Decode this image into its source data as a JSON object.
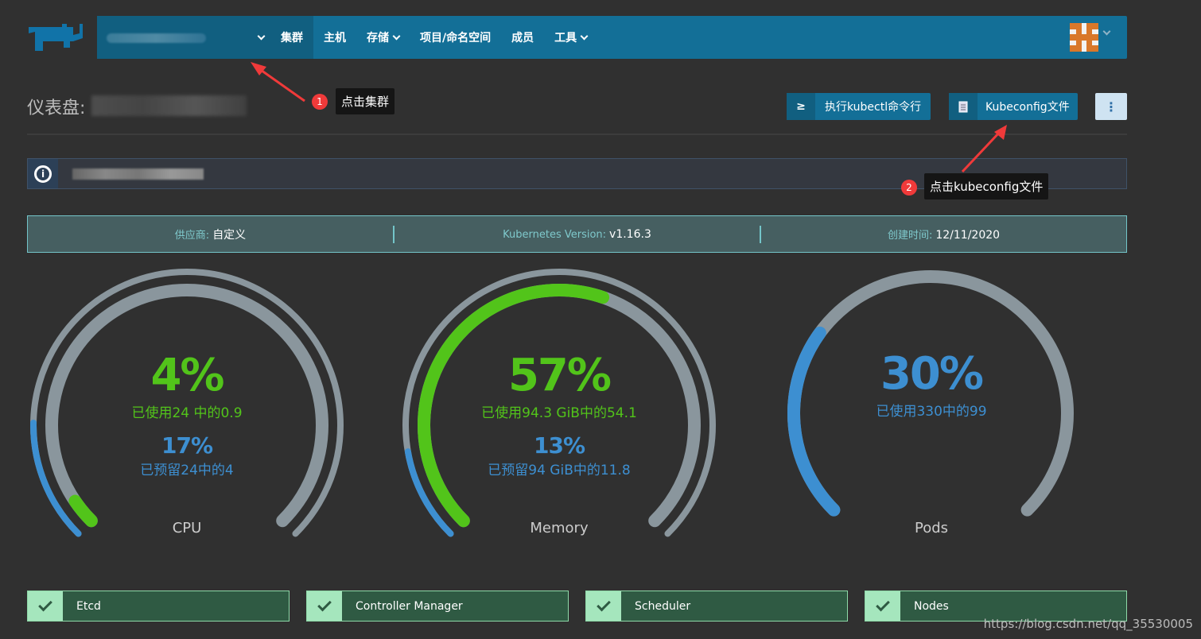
{
  "nav": {
    "items": [
      {
        "label": "集群",
        "active": true,
        "dropdown": false
      },
      {
        "label": "主机",
        "dropdown": false
      },
      {
        "label": "存储",
        "dropdown": true
      },
      {
        "label": "项目/命名空间",
        "dropdown": false
      },
      {
        "label": "成员",
        "dropdown": false
      },
      {
        "label": "工具",
        "dropdown": true
      }
    ]
  },
  "page": {
    "title": "仪表盘:"
  },
  "toolbar": {
    "kubectl_label": "执行kubectl命令行",
    "kubectl_icon": "≥",
    "kubeconfig_label": "Kubeconfig文件",
    "more_icon": "⋮"
  },
  "meta": {
    "provider_key": "供应商:",
    "provider_value": "自定义",
    "k8s_key": "Kubernetes Version:",
    "k8s_value": "v1.16.3",
    "created_key": "创建时间:",
    "created_value": "12/11/2020"
  },
  "gauges": [
    {
      "name": "CPU",
      "used_pct": "4%",
      "used_text": "已使用24 中的0.9",
      "used": 4,
      "reserved_pct": "17%",
      "reserved_text": "已预留24中的4",
      "reserved": 17
    },
    {
      "name": "Memory",
      "used_pct": "57%",
      "used_text": "已使用94.3 GiB中的54.1",
      "used": 57,
      "reserved_pct": "13%",
      "reserved_text": "已预留94 GiB中的11.8",
      "reserved": 13
    },
    {
      "name": "Pods",
      "used_pct": "30%",
      "used_text": "已使用330中的99",
      "used": 30
    }
  ],
  "status": [
    {
      "label": "Etcd"
    },
    {
      "label": "Controller Manager"
    },
    {
      "label": "Scheduler"
    },
    {
      "label": "Nodes"
    }
  ],
  "annotations": [
    {
      "num": "1",
      "text": "点击集群"
    },
    {
      "num": "2",
      "text": "点击kubeconfig文件"
    }
  ],
  "watermark": "https://blog.csdn.net/qq_35530005",
  "colors": {
    "nav": "#136f97",
    "used": "#52c41a",
    "reserved": "#3d8fd1",
    "track": "#8a969d",
    "status_bg": "#2f5a43"
  }
}
